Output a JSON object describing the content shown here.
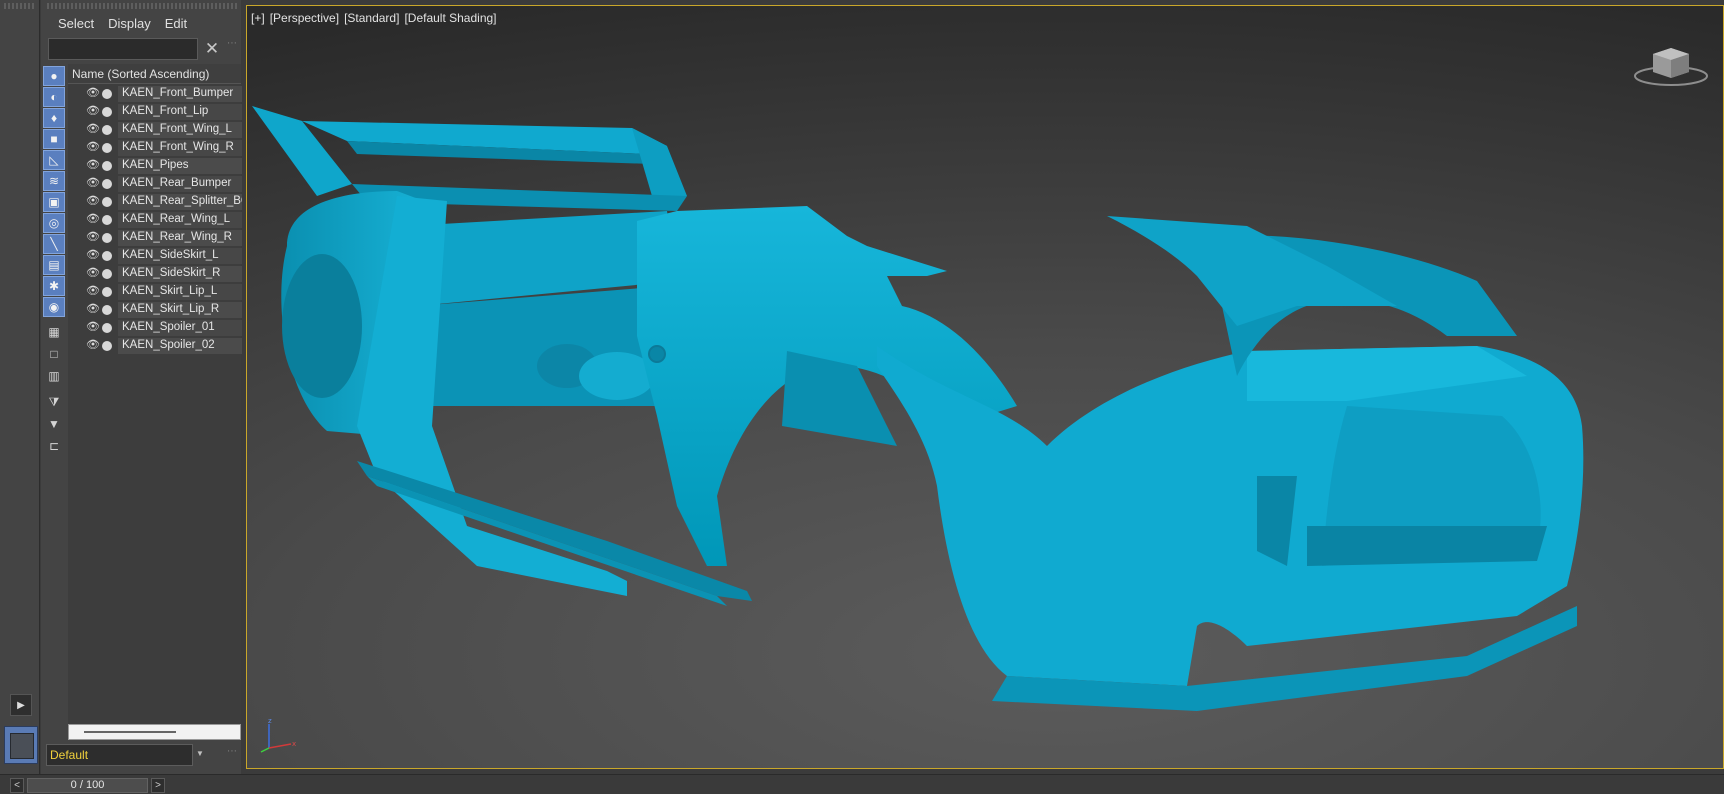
{
  "explorer": {
    "menu": [
      "Select",
      "Display",
      "Edit"
    ],
    "search": {
      "value": "",
      "placeholder": ""
    },
    "column_header": "Name (Sorted Ascending)",
    "objects": [
      "KAEN_Front_Bumper",
      "KAEN_Front_Lip",
      "KAEN_Front_Wing_L",
      "KAEN_Front_Wing_R",
      "KAEN_Pipes",
      "KAEN_Rear_Bumper",
      "KAEN_Rear_Splitter_BOI",
      "KAEN_Rear_Wing_L",
      "KAEN_Rear_Wing_R",
      "KAEN_SideSkirt_L",
      "KAEN_SideSkirt_R",
      "KAEN_Skirt_Lip_L",
      "KAEN_Skirt_Lip_R",
      "KAEN_Spoiler_01",
      "KAEN_Spoiler_02"
    ],
    "layer": "Default"
  },
  "viewport": {
    "labels": [
      "[+]",
      "[Perspective]",
      "[Standard]",
      "[Default Shading]"
    ],
    "model_color": "#00b0d4",
    "active_border_color": "#c9a72a"
  },
  "timeline": {
    "frame_display": "0 / 100",
    "prev_icon": "chevron-left-icon",
    "next_icon": "chevron-right-icon"
  }
}
